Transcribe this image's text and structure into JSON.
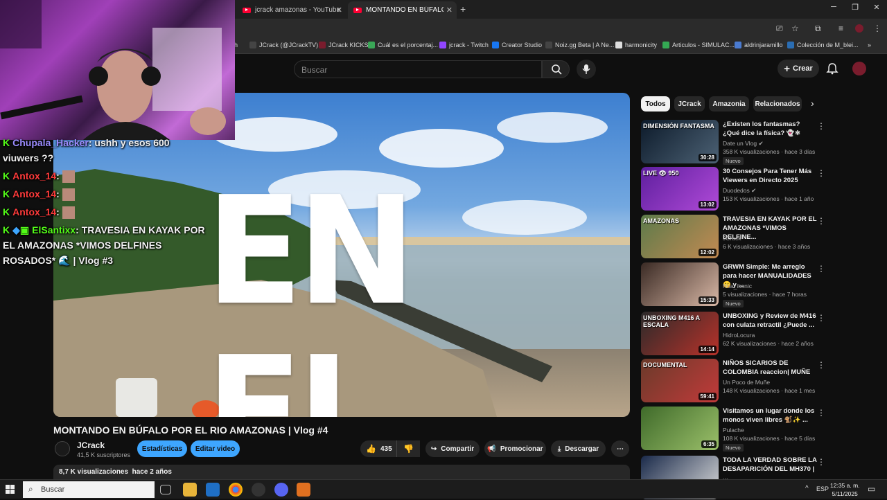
{
  "browser": {
    "tabs": [
      {
        "label": "jcrack amazonas - YouTube",
        "active": false
      },
      {
        "label": "MONTANDO EN BÚFALO POR EL",
        "active": true
      }
    ],
    "new_tab_icon": "plus-icon",
    "bookmarks": [
      {
        "label": "h",
        "icon_color": "#555555"
      },
      {
        "label": "JCrack (@JCrackTV)...",
        "icon_color": "#444444"
      },
      {
        "label": "JCrack KICKS",
        "icon_color": "#7a1c2d"
      },
      {
        "label": "Cuál es el porcentaj...",
        "icon_color": "#3aa757"
      },
      {
        "label": "jcrack - Twitch",
        "icon_color": "#9146ff"
      },
      {
        "label": "Creator Studio",
        "icon_color": "#1877f2"
      },
      {
        "label": "Noiz.gg Beta | A Ne...",
        "icon_color": "#444444"
      },
      {
        "label": "harmonicity",
        "icon_color": "#dddddd"
      },
      {
        "label": "Articulos - SIMULAC...",
        "icon_color": "#34a853"
      },
      {
        "label": "aldrinjaramillo",
        "icon_color": "#4a7bd1"
      },
      {
        "label": "Colección de M_blei...",
        "icon_color": "#2a6db3"
      }
    ]
  },
  "youtube": {
    "search_placeholder": "Buscar",
    "create_label": "Crear",
    "video": {
      "overlay_text": "EN EL",
      "title": "MONTANDO EN BÚFALO POR EL RIO AMAZONAS | Vlog #4",
      "channel": "JCrack",
      "subscribers": "41,5 K suscriptores",
      "stats_button": "Estadísticas",
      "edit_button": "Editar video",
      "likes": "435",
      "share_label": "Compartir",
      "promote_label": "Promocionar",
      "download_label": "Descargar",
      "views": "8,7 K visualizaciones",
      "age": "hace 2 años"
    },
    "chips": [
      "Todos",
      "JCrack",
      "Amazonia",
      "Relacionados"
    ],
    "recommendations": [
      {
        "title": "¿Existen los fantasmas? ¿Qué dice la física? 👻⚛",
        "channel": "Date un Vlog",
        "verified": true,
        "meta": "358 K visualizaciones · hace 3 días",
        "duration": "30:28",
        "badge": "Nuevo",
        "thumb_text": "DIMENSIÓN FANTASMA",
        "colors": [
          "#0c1a2a",
          "#4d6275"
        ]
      },
      {
        "title": "30 Consejos Para Tener Más Viewers en Directo 2025",
        "channel": "Duodedos",
        "verified": true,
        "meta": "153 K visualizaciones · hace 1 año",
        "duration": "13:02",
        "badge": "",
        "thumb_text": "LIVE 👁 950",
        "colors": [
          "#5e1f9e",
          "#b04ad8"
        ]
      },
      {
        "title": "TRAVESIA EN KAYAK POR EL AMAZONAS *VIMOS DELFINE...",
        "channel": "JCrack",
        "verified": false,
        "meta": "6 K visualizaciones · hace 3 años",
        "duration": "12:02",
        "badge": "",
        "thumb_text": "AMAZONAS",
        "colors": [
          "#5c7a4a",
          "#c38a52"
        ]
      },
      {
        "title": "GRWM Simple: Me arreglo para hacer MANUALIDADES 🤫 y ...",
        "channel": "Noa_ikonic",
        "verified": false,
        "meta": "5 visualizaciones · hace 7 horas",
        "duration": "15:33",
        "badge": "Nuevo",
        "thumb_text": "",
        "colors": [
          "#3a2a24",
          "#d9b8a6"
        ]
      },
      {
        "title": "UNBOXING y Review de M416 con culata retractil ¿Puede ...",
        "channel": "HidroLocura",
        "verified": false,
        "meta": "62 K visualizaciones · hace 2 años",
        "duration": "14:14",
        "badge": "",
        "thumb_text": "UNBOXING M416 A ESCALA",
        "colors": [
          "#2a2a2a",
          "#b8322a"
        ]
      },
      {
        "title": "NIÑOS SICARIOS DE COLOMBIA reaccion| MUÑE",
        "channel": "Un Poco de Muñe",
        "verified": false,
        "meta": "148 K visualizaciones · hace 1 mes",
        "duration": "59:41",
        "badge": "",
        "thumb_text": "DOCUMENTAL",
        "colors": [
          "#6a3a2a",
          "#c23a3a"
        ]
      },
      {
        "title": "Visitamos un lugar donde los monos viven libres 🐒✨ ...",
        "channel": "Pulache",
        "verified": false,
        "meta": "108 K visualizaciones · hace 5 días",
        "duration": "6:35",
        "badge": "Nuevo",
        "thumb_text": "",
        "colors": [
          "#3f6a2a",
          "#9bc06a"
        ]
      },
      {
        "title": "TODA LA VERDAD SOBRE LA DESAPARICIÓN DEL MH370 | ...",
        "channel": "",
        "verified": false,
        "meta": "",
        "duration": "",
        "badge": "",
        "thumb_text": "",
        "colors": [
          "#1a2a4a",
          "#dddddd"
        ]
      }
    ]
  },
  "stream_chat": [
    {
      "user": "Chupala_Hacker",
      "user_color": "#9b8cff",
      "text": ": ushh y esos 600",
      "cont": "viuwers ??"
    },
    {
      "user": "Antox_14",
      "user_color": "#ff3b3b",
      "text": ":",
      "cont": ""
    },
    {
      "user": "Antox_14",
      "user_color": "#ff3b3b",
      "text": ":",
      "cont": ""
    },
    {
      "user": "Antox_14",
      "user_color": "#ff3b3b",
      "text": ":",
      "cont": ""
    },
    {
      "user": "ElSantixx",
      "user_color": "#53fc18",
      "text": ": TRAVESIA EN KAYAK POR",
      "cont": "EL AMAZONAS *VIMOS DELFINES",
      "cont2": "ROSADOS* 🌊 | Vlog #3"
    }
  ],
  "taskbar": {
    "search_label": "Buscar",
    "language": "ESP",
    "time": "12:35 a. m.",
    "date": "5/11/2025"
  }
}
